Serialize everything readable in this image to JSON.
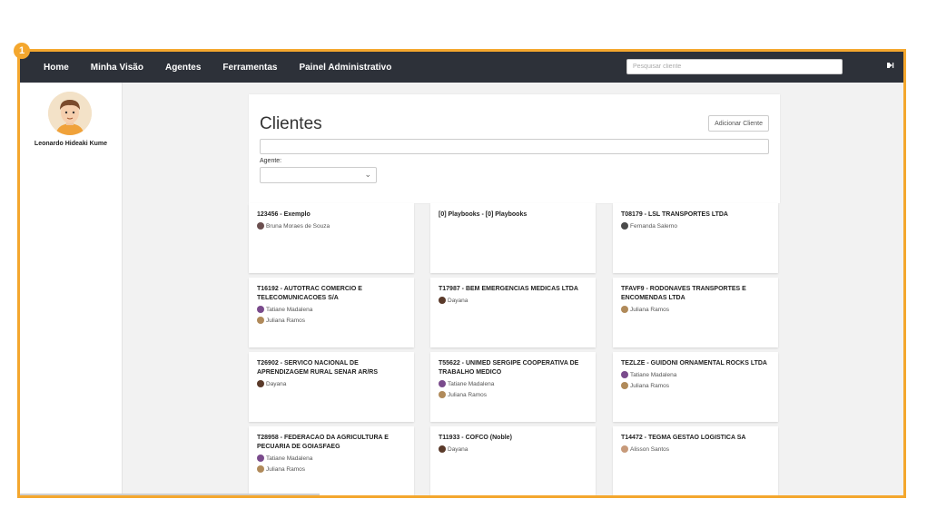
{
  "annotation": {
    "badge": "1"
  },
  "nav": {
    "items": [
      "Home",
      "Minha Visão",
      "Agentes",
      "Ferramentas",
      "Painel Administrativo"
    ],
    "search_placeholder": "Pesquisar cliente",
    "logout_icon": "logout-icon"
  },
  "sidebar": {
    "user_name": "Leonardo Hideaki Kume"
  },
  "main": {
    "title": "Clientes",
    "add_button": "Adicionar Cliente",
    "agent_label": "Agente:"
  },
  "cards": [
    {
      "title": "123456 - Exemplo",
      "agents": [
        "Bruna Moraes de Souza"
      ]
    },
    {
      "title": "[0] Playbooks - [0] Playbooks",
      "agents": []
    },
    {
      "title": "T08179 - LSL TRANSPORTES LTDA",
      "agents": [
        "Fernanda Salerno"
      ]
    },
    {
      "title": "T16192 - AUTOTRAC COMERCIO E TELECOMUNICACOES S/A",
      "agents": [
        "Tatiane Madalena",
        "Juliana Ramos"
      ]
    },
    {
      "title": "T17987 - BEM EMERGENCIAS MEDICAS LTDA",
      "agents": [
        "Dayana"
      ]
    },
    {
      "title": "TFAVF9 - RODONAVES TRANSPORTES E ENCOMENDAS LTDA",
      "agents": [
        "Juliana Ramos"
      ]
    },
    {
      "title": "T26902 - SERVICO NACIONAL DE APRENDIZAGEM RURAL SENAR AR/RS",
      "agents": [
        "Dayana"
      ]
    },
    {
      "title": "T55622 - UNIMED SERGIPE COOPERATIVA DE TRABALHO MEDICO",
      "agents": [
        "Tatiane Madalena",
        "Juliana Ramos"
      ]
    },
    {
      "title": "TEZLZE - GUIDONI ORNAMENTAL ROCKS LTDA",
      "agents": [
        "Tatiane Madalena",
        "Juliana Ramos"
      ]
    },
    {
      "title": "T28958 - FEDERACAO DA AGRICULTURA E PECUARIA DE GOIASFAEG",
      "agents": [
        "Tatiane Madalena",
        "Juliana Ramos"
      ]
    },
    {
      "title": "T11933 - COFCO (Noble)",
      "agents": [
        "Dayana"
      ]
    },
    {
      "title": "T14472 - TEGMA GESTAO LOGISTICA SA",
      "agents": [
        "Alisson Santos"
      ]
    }
  ],
  "agent_colors": {
    "Bruna Moraes de Souza": "#6b4f4f",
    "Fernanda Salerno": "#4a4a4a",
    "Tatiane Madalena": "#7a4b8c",
    "Juliana Ramos": "#b08a5a",
    "Dayana": "#5a3a2a",
    "Alisson Santos": "#c79a7a"
  }
}
